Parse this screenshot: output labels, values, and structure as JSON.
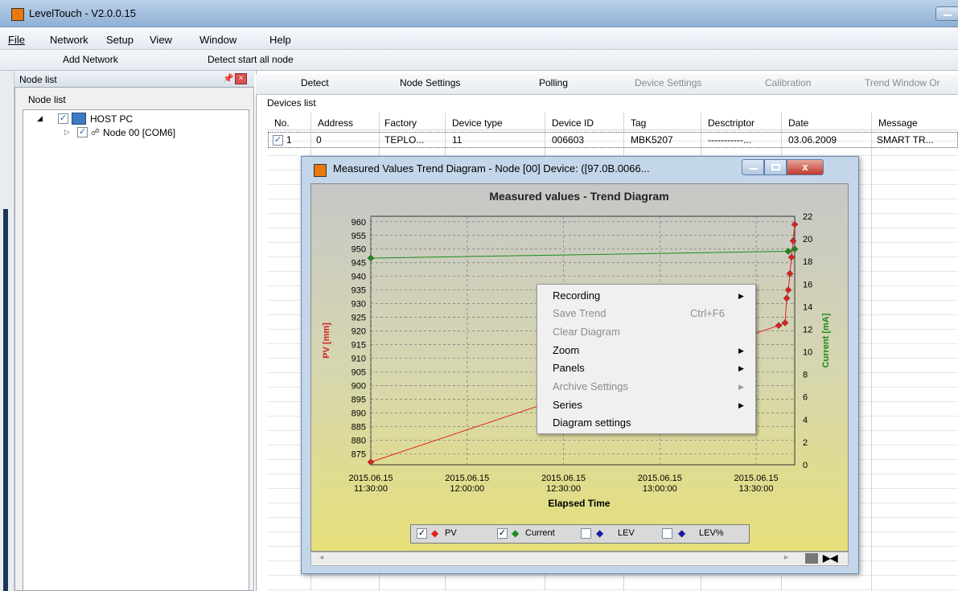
{
  "window": {
    "title": "LevelTouch - V2.0.0.15"
  },
  "menu": [
    "File",
    "Network",
    "Setup",
    "View",
    "Window",
    "Help"
  ],
  "toolbar": {
    "add_network": "Add Network",
    "detect_all": "Detect start all node"
  },
  "left_panel": {
    "header": "Node list",
    "tab": "Node list",
    "tree": [
      {
        "label": "HOST PC",
        "checked": true
      },
      {
        "label": "Node 00 [COM6]",
        "checked": true
      }
    ]
  },
  "tabs": [
    {
      "label": "Detect",
      "enabled": true
    },
    {
      "label": "Node Settings",
      "enabled": true
    },
    {
      "label": "Polling",
      "enabled": true
    },
    {
      "label": "Device Settings",
      "enabled": false
    },
    {
      "label": "Calibration",
      "enabled": false
    },
    {
      "label": "Trend Window Or",
      "enabled": false
    }
  ],
  "devices": {
    "title": "Devices list",
    "columns": [
      "No.",
      "Address",
      "Factory",
      "Device type",
      "Device ID",
      "Tag",
      "Desctriptor",
      "Date",
      "Message"
    ],
    "rows": [
      {
        "no": "1",
        "address": "0",
        "factory": "TEPLO...",
        "type": "11",
        "id": "006603",
        "tag": "MBK5207",
        "descriptor": "-----------...",
        "date": "03.06.2009",
        "message": "SMART TR..."
      }
    ]
  },
  "trend_window": {
    "title": "Measured Values Trend Diagram - Node [00] Device: ([97.0B.0066..."
  },
  "context_menu": [
    {
      "label": "Recording",
      "enabled": true,
      "submenu": true
    },
    {
      "label": "Save Trend",
      "enabled": false,
      "shortcut": "Ctrl+F6"
    },
    {
      "label": "Clear Diagram",
      "enabled": false
    },
    {
      "label": "Zoom",
      "enabled": true,
      "submenu": true
    },
    {
      "label": "Panels",
      "enabled": true,
      "submenu": true
    },
    {
      "label": "Archive Settings",
      "enabled": false,
      "submenu": true
    },
    {
      "label": "Series",
      "enabled": true,
      "submenu": true
    },
    {
      "label": "Diagram settings",
      "enabled": true
    }
  ],
  "chart_data": {
    "type": "line",
    "title": "Measured values - Trend Diagram",
    "xlabel": "Elapsed Time",
    "ylabel": "PV [mm]",
    "y2label": "Current [mA]",
    "x_ticks": [
      [
        "2015.06.15",
        "11:30:00"
      ],
      [
        "2015.06.15",
        "12:00:00"
      ],
      [
        "2015.06.15",
        "12:30:00"
      ],
      [
        "2015.06.15",
        "13:00:00"
      ],
      [
        "2015.06.15",
        "13:30:00"
      ]
    ],
    "y_ticks": [
      960,
      955,
      950,
      945,
      940,
      935,
      930,
      925,
      920,
      915,
      910,
      905,
      900,
      895,
      890,
      885,
      880,
      875
    ],
    "y2_ticks": [
      22,
      20,
      18,
      16,
      14,
      12,
      10,
      8,
      6,
      4,
      2,
      0
    ],
    "ylim": [
      871,
      962
    ],
    "y2lim": [
      0,
      22
    ],
    "grid": true,
    "legend": [
      {
        "label": "PV",
        "checked": true,
        "color": "#e02020"
      },
      {
        "label": "Current",
        "checked": true,
        "color": "#1a8a1a"
      },
      {
        "label": "LEV",
        "checked": false,
        "color": "#1a1aa0"
      },
      {
        "label": "LEV%",
        "checked": false,
        "color": "#1a1aa0"
      }
    ],
    "series": [
      {
        "name": "PV",
        "axis": "left",
        "color": "#e02020",
        "points": [
          [
            "11:30",
            872
          ],
          [
            "13:37",
            922
          ],
          [
            "13:39",
            923
          ],
          [
            "13:39.5",
            932
          ],
          [
            "13:40",
            935
          ],
          [
            "13:40.5",
            941
          ],
          [
            "13:41",
            947
          ],
          [
            "13:41.5",
            953
          ],
          [
            "13:42",
            959
          ]
        ]
      },
      {
        "name": "Current",
        "axis": "right",
        "color": "#1a8a1a",
        "points": [
          [
            "11:30",
            18.3
          ],
          [
            "13:40",
            18.9
          ],
          [
            "13:42",
            19.1
          ]
        ]
      }
    ]
  }
}
